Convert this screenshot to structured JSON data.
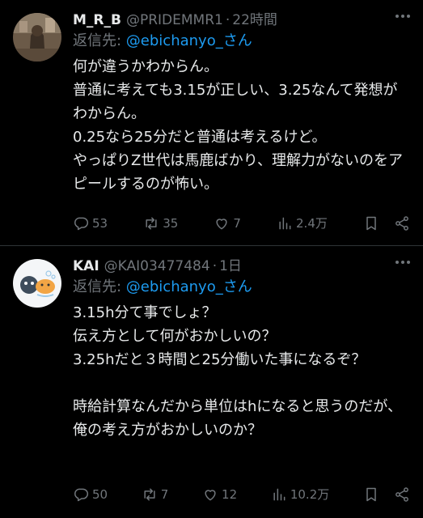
{
  "posts": [
    {
      "name": "M_R_B",
      "handle": "@PRIDEMMR1",
      "dot": "·",
      "time": "22時間",
      "reply_prefix": "返信先: ",
      "reply_to": "@ebichanyo_さん",
      "text": "何が違うかわからん。\n普通に考えても3.15が正しい、3.25なんて発想がわからん。\n0.25なら25分だと普通は考えるけど。\nやっぱりZ世代は馬鹿ばかり、理解力がないのをアピールするのが怖い。",
      "replies": "53",
      "reposts": "35",
      "likes": "7",
      "views": "2.4万"
    },
    {
      "name": "KAI",
      "handle": "@KAI03477484",
      "dot": "·",
      "time": "1日",
      "reply_prefix": "返信先: ",
      "reply_to": "@ebichanyo_さん",
      "text": "3.15h分て事でしょ？\n伝え方として何がおかしいの？\n3.25hだと３時間と25分働いた事になるぞ？\n\n時給計算なんだから単位はhになると思うのだが、俺の考え方がおかしいのか？",
      "replies": "50",
      "reposts": "7",
      "likes": "12",
      "views": "10.2万"
    }
  ],
  "colors": {
    "background": "#000000",
    "text": "#e7e9ea",
    "secondary": "#71767b",
    "link": "#1d9bf0",
    "divider": "#2f3336"
  },
  "icons": [
    "more-icon",
    "reply-icon",
    "repost-icon",
    "like-icon",
    "views-icon",
    "bookmark-icon",
    "share-icon"
  ]
}
